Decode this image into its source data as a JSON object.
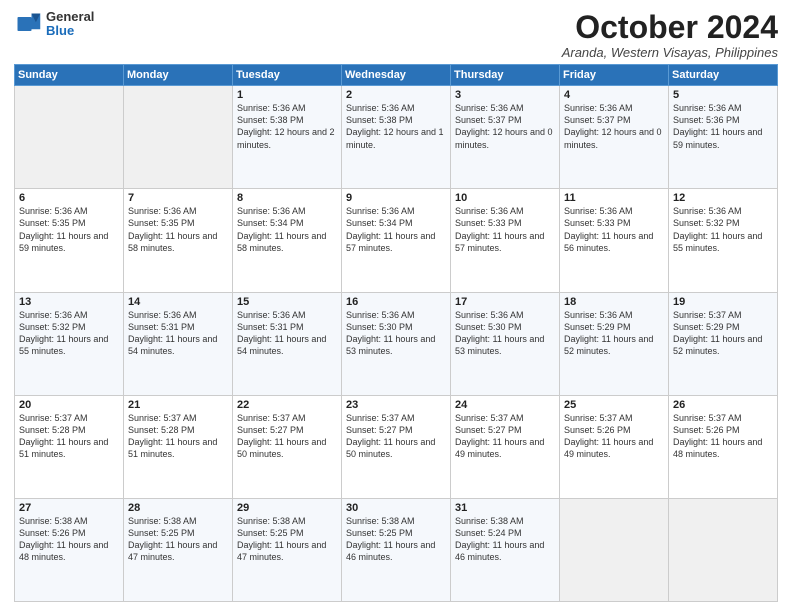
{
  "logo": {
    "general": "General",
    "blue": "Blue"
  },
  "header": {
    "month": "October 2024",
    "location": "Aranda, Western Visayas, Philippines"
  },
  "days_of_week": [
    "Sunday",
    "Monday",
    "Tuesday",
    "Wednesday",
    "Thursday",
    "Friday",
    "Saturday"
  ],
  "weeks": [
    [
      {
        "day": "",
        "sunrise": "",
        "sunset": "",
        "daylight": ""
      },
      {
        "day": "",
        "sunrise": "",
        "sunset": "",
        "daylight": ""
      },
      {
        "day": "1",
        "sunrise": "Sunrise: 5:36 AM",
        "sunset": "Sunset: 5:38 PM",
        "daylight": "Daylight: 12 hours and 2 minutes."
      },
      {
        "day": "2",
        "sunrise": "Sunrise: 5:36 AM",
        "sunset": "Sunset: 5:38 PM",
        "daylight": "Daylight: 12 hours and 1 minute."
      },
      {
        "day": "3",
        "sunrise": "Sunrise: 5:36 AM",
        "sunset": "Sunset: 5:37 PM",
        "daylight": "Daylight: 12 hours and 0 minutes."
      },
      {
        "day": "4",
        "sunrise": "Sunrise: 5:36 AM",
        "sunset": "Sunset: 5:37 PM",
        "daylight": "Daylight: 12 hours and 0 minutes."
      },
      {
        "day": "5",
        "sunrise": "Sunrise: 5:36 AM",
        "sunset": "Sunset: 5:36 PM",
        "daylight": "Daylight: 11 hours and 59 minutes."
      }
    ],
    [
      {
        "day": "6",
        "sunrise": "Sunrise: 5:36 AM",
        "sunset": "Sunset: 5:35 PM",
        "daylight": "Daylight: 11 hours and 59 minutes."
      },
      {
        "day": "7",
        "sunrise": "Sunrise: 5:36 AM",
        "sunset": "Sunset: 5:35 PM",
        "daylight": "Daylight: 11 hours and 58 minutes."
      },
      {
        "day": "8",
        "sunrise": "Sunrise: 5:36 AM",
        "sunset": "Sunset: 5:34 PM",
        "daylight": "Daylight: 11 hours and 58 minutes."
      },
      {
        "day": "9",
        "sunrise": "Sunrise: 5:36 AM",
        "sunset": "Sunset: 5:34 PM",
        "daylight": "Daylight: 11 hours and 57 minutes."
      },
      {
        "day": "10",
        "sunrise": "Sunrise: 5:36 AM",
        "sunset": "Sunset: 5:33 PM",
        "daylight": "Daylight: 11 hours and 57 minutes."
      },
      {
        "day": "11",
        "sunrise": "Sunrise: 5:36 AM",
        "sunset": "Sunset: 5:33 PM",
        "daylight": "Daylight: 11 hours and 56 minutes."
      },
      {
        "day": "12",
        "sunrise": "Sunrise: 5:36 AM",
        "sunset": "Sunset: 5:32 PM",
        "daylight": "Daylight: 11 hours and 55 minutes."
      }
    ],
    [
      {
        "day": "13",
        "sunrise": "Sunrise: 5:36 AM",
        "sunset": "Sunset: 5:32 PM",
        "daylight": "Daylight: 11 hours and 55 minutes."
      },
      {
        "day": "14",
        "sunrise": "Sunrise: 5:36 AM",
        "sunset": "Sunset: 5:31 PM",
        "daylight": "Daylight: 11 hours and 54 minutes."
      },
      {
        "day": "15",
        "sunrise": "Sunrise: 5:36 AM",
        "sunset": "Sunset: 5:31 PM",
        "daylight": "Daylight: 11 hours and 54 minutes."
      },
      {
        "day": "16",
        "sunrise": "Sunrise: 5:36 AM",
        "sunset": "Sunset: 5:30 PM",
        "daylight": "Daylight: 11 hours and 53 minutes."
      },
      {
        "day": "17",
        "sunrise": "Sunrise: 5:36 AM",
        "sunset": "Sunset: 5:30 PM",
        "daylight": "Daylight: 11 hours and 53 minutes."
      },
      {
        "day": "18",
        "sunrise": "Sunrise: 5:36 AM",
        "sunset": "Sunset: 5:29 PM",
        "daylight": "Daylight: 11 hours and 52 minutes."
      },
      {
        "day": "19",
        "sunrise": "Sunrise: 5:37 AM",
        "sunset": "Sunset: 5:29 PM",
        "daylight": "Daylight: 11 hours and 52 minutes."
      }
    ],
    [
      {
        "day": "20",
        "sunrise": "Sunrise: 5:37 AM",
        "sunset": "Sunset: 5:28 PM",
        "daylight": "Daylight: 11 hours and 51 minutes."
      },
      {
        "day": "21",
        "sunrise": "Sunrise: 5:37 AM",
        "sunset": "Sunset: 5:28 PM",
        "daylight": "Daylight: 11 hours and 51 minutes."
      },
      {
        "day": "22",
        "sunrise": "Sunrise: 5:37 AM",
        "sunset": "Sunset: 5:27 PM",
        "daylight": "Daylight: 11 hours and 50 minutes."
      },
      {
        "day": "23",
        "sunrise": "Sunrise: 5:37 AM",
        "sunset": "Sunset: 5:27 PM",
        "daylight": "Daylight: 11 hours and 50 minutes."
      },
      {
        "day": "24",
        "sunrise": "Sunrise: 5:37 AM",
        "sunset": "Sunset: 5:27 PM",
        "daylight": "Daylight: 11 hours and 49 minutes."
      },
      {
        "day": "25",
        "sunrise": "Sunrise: 5:37 AM",
        "sunset": "Sunset: 5:26 PM",
        "daylight": "Daylight: 11 hours and 49 minutes."
      },
      {
        "day": "26",
        "sunrise": "Sunrise: 5:37 AM",
        "sunset": "Sunset: 5:26 PM",
        "daylight": "Daylight: 11 hours and 48 minutes."
      }
    ],
    [
      {
        "day": "27",
        "sunrise": "Sunrise: 5:38 AM",
        "sunset": "Sunset: 5:26 PM",
        "daylight": "Daylight: 11 hours and 48 minutes."
      },
      {
        "day": "28",
        "sunrise": "Sunrise: 5:38 AM",
        "sunset": "Sunset: 5:25 PM",
        "daylight": "Daylight: 11 hours and 47 minutes."
      },
      {
        "day": "29",
        "sunrise": "Sunrise: 5:38 AM",
        "sunset": "Sunset: 5:25 PM",
        "daylight": "Daylight: 11 hours and 47 minutes."
      },
      {
        "day": "30",
        "sunrise": "Sunrise: 5:38 AM",
        "sunset": "Sunset: 5:25 PM",
        "daylight": "Daylight: 11 hours and 46 minutes."
      },
      {
        "day": "31",
        "sunrise": "Sunrise: 5:38 AM",
        "sunset": "Sunset: 5:24 PM",
        "daylight": "Daylight: 11 hours and 46 minutes."
      },
      {
        "day": "",
        "sunrise": "",
        "sunset": "",
        "daylight": ""
      },
      {
        "day": "",
        "sunrise": "",
        "sunset": "",
        "daylight": ""
      }
    ]
  ]
}
